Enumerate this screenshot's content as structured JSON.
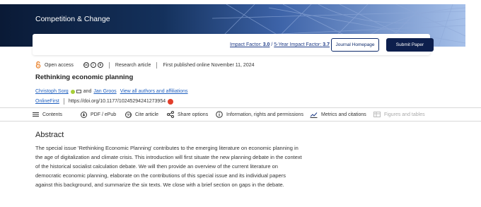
{
  "banner": {
    "journal_title": "Competition & Change"
  },
  "impact": {
    "impact_factor_label": "Impact Factor: ",
    "impact_factor_value": "3.0",
    "five_year_label": "5-Year Impact Factor: ",
    "five_year_value": "3.7",
    "journal_homepage": "Journal Homepage",
    "submit_paper": "Submit Paper"
  },
  "meta": {
    "open_access": "Open access",
    "article_type": "Research article",
    "published": "First published online November 11, 2024"
  },
  "article": {
    "title": "Rethinking economic planning",
    "author1": "Christoph Sorg",
    "and": "and",
    "author2": "Jan Groos",
    "view_all": "View all authors and affiliations",
    "online_first": "OnlineFirst",
    "doi": "https://doi.org/10.1177/10245294241273954"
  },
  "toolbar": {
    "contents": "Contents",
    "pdf": "PDF / ePub",
    "cite": "Cite article",
    "share": "Share options",
    "info": "Information, rights and permissions",
    "metrics": "Metrics and citations",
    "figures": "Figures and tables"
  },
  "abstract": {
    "heading": "Abstract",
    "text": "The special issue 'Rethinking Economic Planning' contributes to the emerging literature on economic planning in the age of digitalization and climate crisis. This introduction will first situate the new planning debate in the context of the historical socialist calculation debate. We will then provide an overview of the current literature on democratic economic planning, elaborate on the contributions of this special issue and its individual papers against this background, and summarize the six texts. We close with a brief section on gaps in the debate."
  }
}
